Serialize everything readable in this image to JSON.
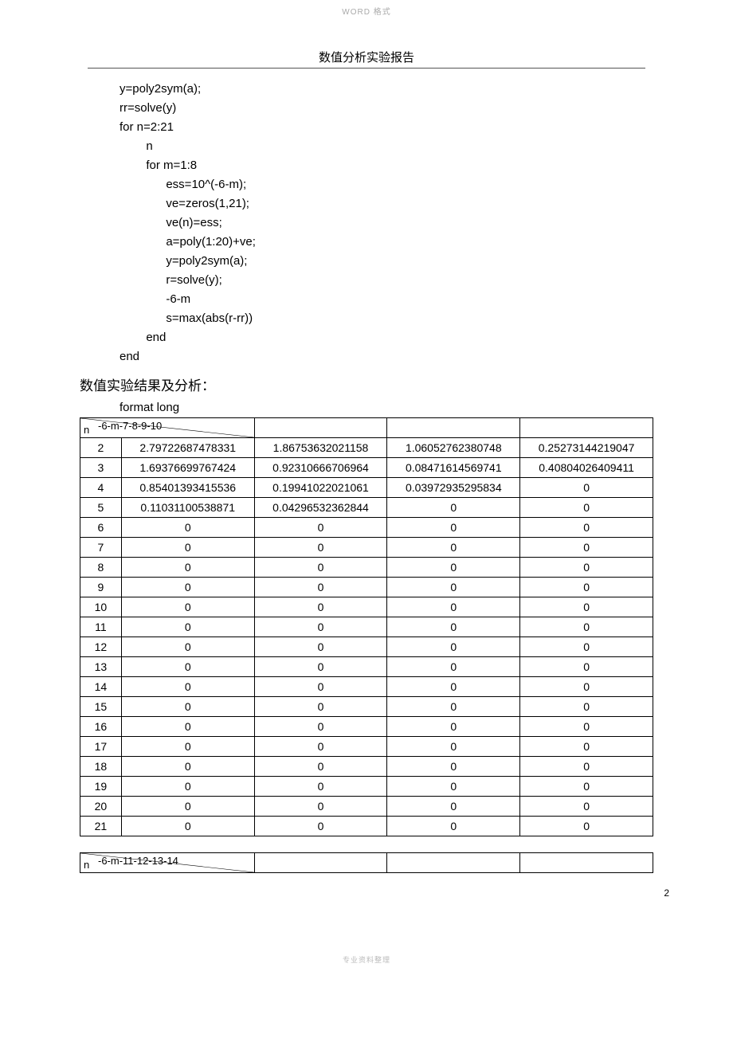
{
  "watermark_top": "WORD 格式",
  "report_title": "数值分析实验报告",
  "code": "y=poly2sym(a);\nrr=solve(y)\nfor n=2:21\n        n\n        for m=1:8\n              ess=10^(-6-m);\n              ve=zeros(1,21);\n              ve(n)=ess;\n              a=poly(1:20)+ve;\n              y=poly2sym(a);\n              r=solve(y);\n              -6-m\n              s=max(abs(r-rr))\n        end\nend",
  "section_heading": "数值实验结果及分析：",
  "format_line": "format long",
  "table1": {
    "header_top": "-6-m-7-8-9-10",
    "header_bottom": "n",
    "rows": [
      {
        "n": "2",
        "v": [
          "2.79722687478331",
          "1.86753632021158",
          "1.06052762380748",
          "0.25273144219047"
        ]
      },
      {
        "n": "3",
        "v": [
          "1.69376699767424",
          "0.92310666706964",
          "0.08471614569741",
          "0.40804026409411"
        ]
      },
      {
        "n": "4",
        "v": [
          "0.85401393415536",
          "0.19941022021061",
          "0.03972935295834",
          "0"
        ]
      },
      {
        "n": "5",
        "v": [
          "0.11031100538871",
          "0.04296532362844",
          "0",
          "0"
        ]
      },
      {
        "n": "6",
        "v": [
          "0",
          "0",
          "0",
          "0"
        ]
      },
      {
        "n": "7",
        "v": [
          "0",
          "0",
          "0",
          "0"
        ]
      },
      {
        "n": "8",
        "v": [
          "0",
          "0",
          "0",
          "0"
        ]
      },
      {
        "n": "9",
        "v": [
          "0",
          "0",
          "0",
          "0"
        ]
      },
      {
        "n": "10",
        "v": [
          "0",
          "0",
          "0",
          "0"
        ]
      },
      {
        "n": "11",
        "v": [
          "0",
          "0",
          "0",
          "0"
        ]
      },
      {
        "n": "12",
        "v": [
          "0",
          "0",
          "0",
          "0"
        ]
      },
      {
        "n": "13",
        "v": [
          "0",
          "0",
          "0",
          "0"
        ]
      },
      {
        "n": "14",
        "v": [
          "0",
          "0",
          "0",
          "0"
        ]
      },
      {
        "n": "15",
        "v": [
          "0",
          "0",
          "0",
          "0"
        ]
      },
      {
        "n": "16",
        "v": [
          "0",
          "0",
          "0",
          "0"
        ]
      },
      {
        "n": "17",
        "v": [
          "0",
          "0",
          "0",
          "0"
        ]
      },
      {
        "n": "18",
        "v": [
          "0",
          "0",
          "0",
          "0"
        ]
      },
      {
        "n": "19",
        "v": [
          "0",
          "0",
          "0",
          "0"
        ]
      },
      {
        "n": "20",
        "v": [
          "0",
          "0",
          "0",
          "0"
        ]
      },
      {
        "n": "21",
        "v": [
          "0",
          "0",
          "0",
          "0"
        ]
      }
    ]
  },
  "table2": {
    "header_top": "-6-m-11-12-13-14",
    "header_bottom": "n"
  },
  "page_number": "2",
  "footer": "专业资料整理"
}
